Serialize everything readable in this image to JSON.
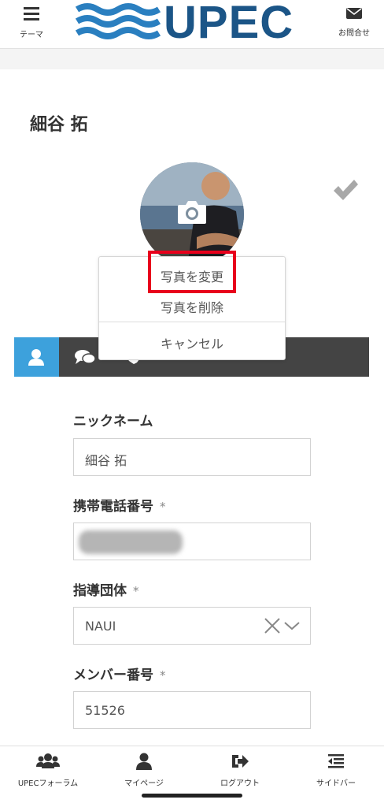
{
  "header": {
    "theme_label": "テーマ",
    "logo_text": "UPEC",
    "contact_label": "お問合せ"
  },
  "profile": {
    "name": "細谷 拓"
  },
  "photo_menu": {
    "change": "写真を変更",
    "delete": "写真を削除",
    "cancel": "キャンセル"
  },
  "tabs": [
    {
      "icon": "user-icon",
      "active": true
    },
    {
      "icon": "comments-icon",
      "active": false
    },
    {
      "icon": "handshake-icon",
      "active": false
    }
  ],
  "form": {
    "nickname_label": "ニックネーム",
    "nickname_value": "細谷 拓",
    "phone_label": "携帯電話番号",
    "phone_required": "*",
    "org_label": "指導団体",
    "org_required": "*",
    "org_value": "NAUI",
    "member_label": "メンバー番号",
    "member_required": "*",
    "member_value": "51526"
  },
  "bottom_nav": [
    {
      "label": "UPECフォーラム",
      "icon": "users-icon"
    },
    {
      "label": "マイページ",
      "icon": "user-icon"
    },
    {
      "label": "ログアウト",
      "icon": "sign-out-icon"
    },
    {
      "label": "サイドバー",
      "icon": "sidebar-icon"
    }
  ],
  "colors": {
    "brand": "#1b5587",
    "active_tab": "#3da1dc",
    "tabbar": "#444444",
    "highlight": "#e8001c"
  }
}
